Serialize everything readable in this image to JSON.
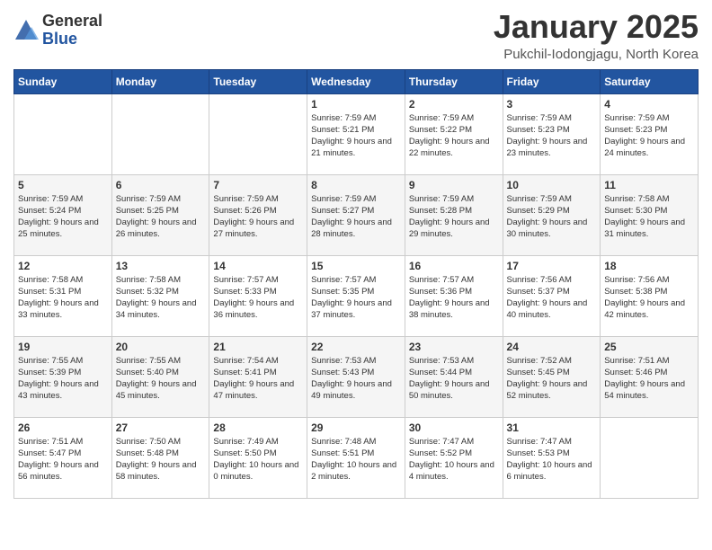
{
  "logo": {
    "general": "General",
    "blue": "Blue"
  },
  "header": {
    "month": "January 2025",
    "location": "Pukchil-Iodongjagu, North Korea"
  },
  "weekdays": [
    "Sunday",
    "Monday",
    "Tuesday",
    "Wednesday",
    "Thursday",
    "Friday",
    "Saturday"
  ],
  "weeks": [
    [
      {
        "day": "",
        "sunrise": "",
        "sunset": "",
        "daylight": ""
      },
      {
        "day": "",
        "sunrise": "",
        "sunset": "",
        "daylight": ""
      },
      {
        "day": "",
        "sunrise": "",
        "sunset": "",
        "daylight": ""
      },
      {
        "day": "1",
        "sunrise": "Sunrise: 7:59 AM",
        "sunset": "Sunset: 5:21 PM",
        "daylight": "Daylight: 9 hours and 21 minutes."
      },
      {
        "day": "2",
        "sunrise": "Sunrise: 7:59 AM",
        "sunset": "Sunset: 5:22 PM",
        "daylight": "Daylight: 9 hours and 22 minutes."
      },
      {
        "day": "3",
        "sunrise": "Sunrise: 7:59 AM",
        "sunset": "Sunset: 5:23 PM",
        "daylight": "Daylight: 9 hours and 23 minutes."
      },
      {
        "day": "4",
        "sunrise": "Sunrise: 7:59 AM",
        "sunset": "Sunset: 5:23 PM",
        "daylight": "Daylight: 9 hours and 24 minutes."
      }
    ],
    [
      {
        "day": "5",
        "sunrise": "Sunrise: 7:59 AM",
        "sunset": "Sunset: 5:24 PM",
        "daylight": "Daylight: 9 hours and 25 minutes."
      },
      {
        "day": "6",
        "sunrise": "Sunrise: 7:59 AM",
        "sunset": "Sunset: 5:25 PM",
        "daylight": "Daylight: 9 hours and 26 minutes."
      },
      {
        "day": "7",
        "sunrise": "Sunrise: 7:59 AM",
        "sunset": "Sunset: 5:26 PM",
        "daylight": "Daylight: 9 hours and 27 minutes."
      },
      {
        "day": "8",
        "sunrise": "Sunrise: 7:59 AM",
        "sunset": "Sunset: 5:27 PM",
        "daylight": "Daylight: 9 hours and 28 minutes."
      },
      {
        "day": "9",
        "sunrise": "Sunrise: 7:59 AM",
        "sunset": "Sunset: 5:28 PM",
        "daylight": "Daylight: 9 hours and 29 minutes."
      },
      {
        "day": "10",
        "sunrise": "Sunrise: 7:59 AM",
        "sunset": "Sunset: 5:29 PM",
        "daylight": "Daylight: 9 hours and 30 minutes."
      },
      {
        "day": "11",
        "sunrise": "Sunrise: 7:58 AM",
        "sunset": "Sunset: 5:30 PM",
        "daylight": "Daylight: 9 hours and 31 minutes."
      }
    ],
    [
      {
        "day": "12",
        "sunrise": "Sunrise: 7:58 AM",
        "sunset": "Sunset: 5:31 PM",
        "daylight": "Daylight: 9 hours and 33 minutes."
      },
      {
        "day": "13",
        "sunrise": "Sunrise: 7:58 AM",
        "sunset": "Sunset: 5:32 PM",
        "daylight": "Daylight: 9 hours and 34 minutes."
      },
      {
        "day": "14",
        "sunrise": "Sunrise: 7:57 AM",
        "sunset": "Sunset: 5:33 PM",
        "daylight": "Daylight: 9 hours and 36 minutes."
      },
      {
        "day": "15",
        "sunrise": "Sunrise: 7:57 AM",
        "sunset": "Sunset: 5:35 PM",
        "daylight": "Daylight: 9 hours and 37 minutes."
      },
      {
        "day": "16",
        "sunrise": "Sunrise: 7:57 AM",
        "sunset": "Sunset: 5:36 PM",
        "daylight": "Daylight: 9 hours and 38 minutes."
      },
      {
        "day": "17",
        "sunrise": "Sunrise: 7:56 AM",
        "sunset": "Sunset: 5:37 PM",
        "daylight": "Daylight: 9 hours and 40 minutes."
      },
      {
        "day": "18",
        "sunrise": "Sunrise: 7:56 AM",
        "sunset": "Sunset: 5:38 PM",
        "daylight": "Daylight: 9 hours and 42 minutes."
      }
    ],
    [
      {
        "day": "19",
        "sunrise": "Sunrise: 7:55 AM",
        "sunset": "Sunset: 5:39 PM",
        "daylight": "Daylight: 9 hours and 43 minutes."
      },
      {
        "day": "20",
        "sunrise": "Sunrise: 7:55 AM",
        "sunset": "Sunset: 5:40 PM",
        "daylight": "Daylight: 9 hours and 45 minutes."
      },
      {
        "day": "21",
        "sunrise": "Sunrise: 7:54 AM",
        "sunset": "Sunset: 5:41 PM",
        "daylight": "Daylight: 9 hours and 47 minutes."
      },
      {
        "day": "22",
        "sunrise": "Sunrise: 7:53 AM",
        "sunset": "Sunset: 5:43 PM",
        "daylight": "Daylight: 9 hours and 49 minutes."
      },
      {
        "day": "23",
        "sunrise": "Sunrise: 7:53 AM",
        "sunset": "Sunset: 5:44 PM",
        "daylight": "Daylight: 9 hours and 50 minutes."
      },
      {
        "day": "24",
        "sunrise": "Sunrise: 7:52 AM",
        "sunset": "Sunset: 5:45 PM",
        "daylight": "Daylight: 9 hours and 52 minutes."
      },
      {
        "day": "25",
        "sunrise": "Sunrise: 7:51 AM",
        "sunset": "Sunset: 5:46 PM",
        "daylight": "Daylight: 9 hours and 54 minutes."
      }
    ],
    [
      {
        "day": "26",
        "sunrise": "Sunrise: 7:51 AM",
        "sunset": "Sunset: 5:47 PM",
        "daylight": "Daylight: 9 hours and 56 minutes."
      },
      {
        "day": "27",
        "sunrise": "Sunrise: 7:50 AM",
        "sunset": "Sunset: 5:48 PM",
        "daylight": "Daylight: 9 hours and 58 minutes."
      },
      {
        "day": "28",
        "sunrise": "Sunrise: 7:49 AM",
        "sunset": "Sunset: 5:50 PM",
        "daylight": "Daylight: 10 hours and 0 minutes."
      },
      {
        "day": "29",
        "sunrise": "Sunrise: 7:48 AM",
        "sunset": "Sunset: 5:51 PM",
        "daylight": "Daylight: 10 hours and 2 minutes."
      },
      {
        "day": "30",
        "sunrise": "Sunrise: 7:47 AM",
        "sunset": "Sunset: 5:52 PM",
        "daylight": "Daylight: 10 hours and 4 minutes."
      },
      {
        "day": "31",
        "sunrise": "Sunrise: 7:47 AM",
        "sunset": "Sunset: 5:53 PM",
        "daylight": "Daylight: 10 hours and 6 minutes."
      },
      {
        "day": "",
        "sunrise": "",
        "sunset": "",
        "daylight": ""
      }
    ]
  ]
}
